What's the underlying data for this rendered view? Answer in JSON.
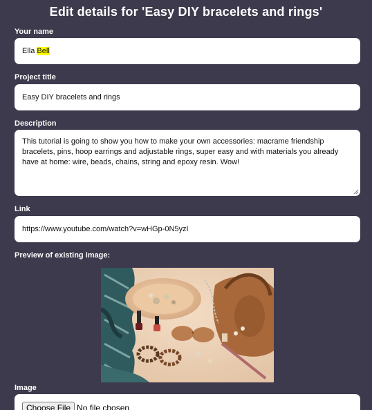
{
  "heading": "Edit details for 'Easy DIY bracelets and rings'",
  "name": {
    "label": "Your name",
    "first": "Ella ",
    "last_highlighted": "Bell"
  },
  "project_title": {
    "label": "Project title",
    "value": "Easy DIY bracelets and rings"
  },
  "description": {
    "label": "Description",
    "value": "This tutorial is going to show you how to make your own accessories: macrame friendship bracelets, pins, hoop earrings and adjustable rings, super easy and with materials you already have at home: wire, beads, chains, string and epoxy resin. Wow!"
  },
  "link": {
    "label": "Link",
    "value": "https://www.youtube.com/watch?v=wHGp-0N5yzI"
  },
  "preview": {
    "label": "Preview of existing image:"
  },
  "image": {
    "label": "Image",
    "button": "Choose File",
    "status": "No file chosen"
  },
  "colors": {
    "background": "#3e3a4d",
    "field": "#ffffff",
    "highlight": "#ffff00"
  }
}
